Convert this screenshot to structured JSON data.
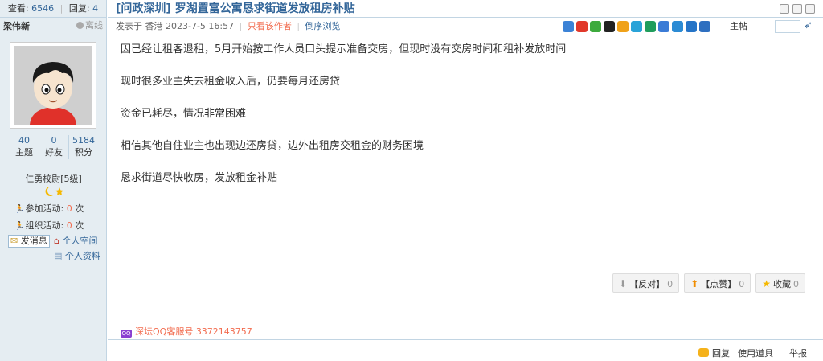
{
  "sidebar": {
    "views_label": "查看:",
    "views": "6546",
    "replies_label": "回复:",
    "replies": "4",
    "author": "梁伟新",
    "status": "离线",
    "stats": [
      {
        "value": "40",
        "label": "主题"
      },
      {
        "value": "0",
        "label": "好友"
      },
      {
        "value": "5184",
        "label": "积分"
      }
    ],
    "rank": "仁勇校尉[5级]",
    "activity_join_label": "参加活动:",
    "activity_join_count": "0",
    "activity_org_label": "组织活动:",
    "activity_org_count": "0",
    "times_unit": "次",
    "send_message": "发消息",
    "personal_space": "个人空间",
    "profile": "个人资料"
  },
  "post": {
    "title": "[问政深圳] 罗湖置富公寓恳求街道发放租房补贴",
    "posted": "发表于 香港 2023-7-5 16:57",
    "only_author": "只看该作者",
    "reverse": "倒序浏览",
    "floor_label": "主帖",
    "paragraphs": [
      "因已经让租客退租，5月开始按工作人员口头提示准备交房，但现时没有交房时间和租补发放时间",
      "现时很多业主失去租金收入后，仍要每月还房贷",
      "资金已耗尽，情况非常困难",
      "相信其他自住业主也出现边还房贷，边外出租房交租金的财务困境",
      "恳求街道尽快收房，发放租金补贴"
    ],
    "actions": [
      {
        "label": "【反对】",
        "count": "0",
        "icon": "down-arrow-icon"
      },
      {
        "label": "【点赞】",
        "count": "0",
        "icon": "up-arrow-icon"
      },
      {
        "label": "收藏",
        "count": "0",
        "icon": "star-icon"
      }
    ],
    "qq_service": "深坛QQ客服号 3372143757",
    "footer": {
      "reply": "回复",
      "tools": "使用道具",
      "report": "举报"
    }
  },
  "colors": {
    "link": "#336699",
    "accent": "#f26c4f",
    "sidebar_bg": "#e5edf2"
  }
}
